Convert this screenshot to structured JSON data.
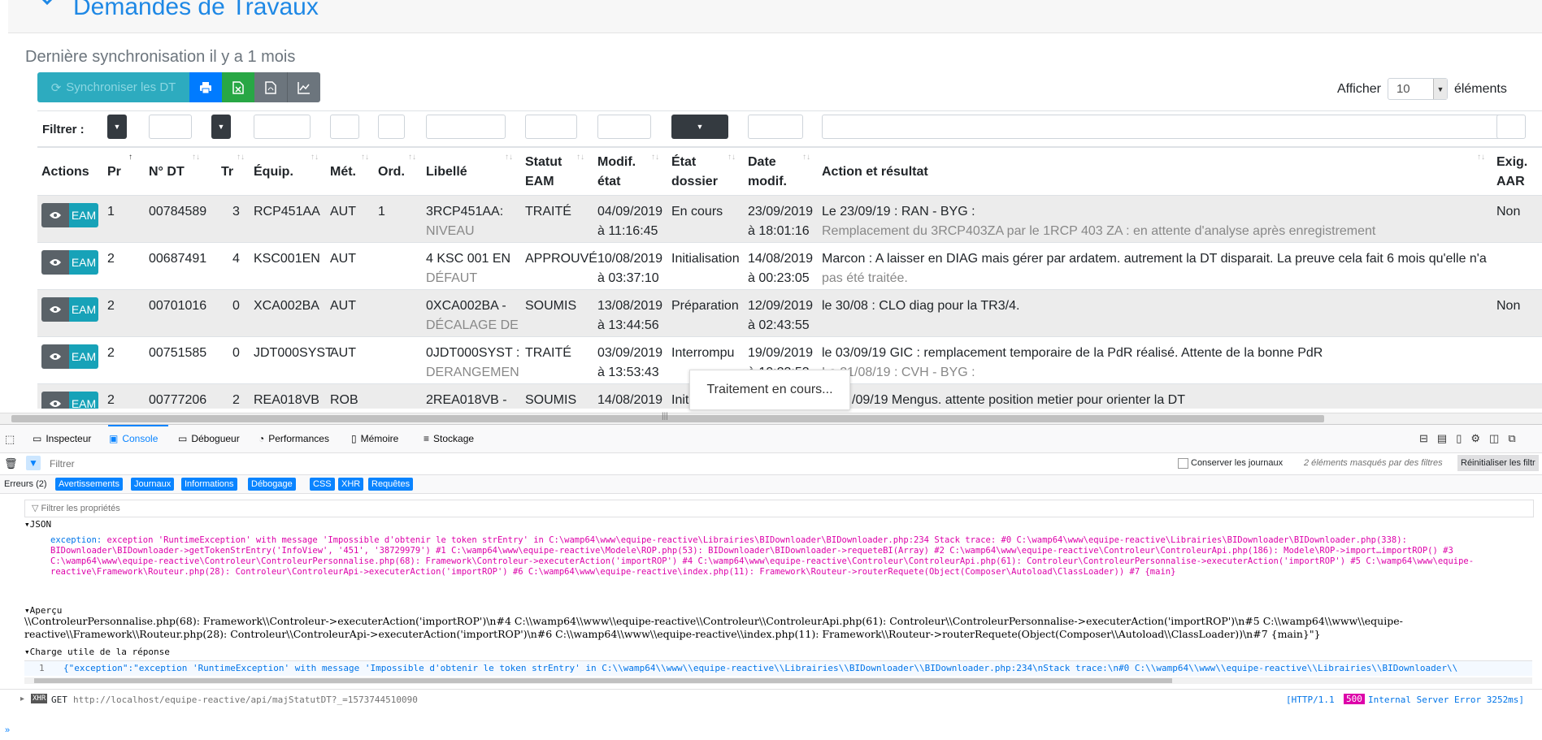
{
  "header": {
    "title": "Demandes de Travaux",
    "sync_text": "Dernière synchronisation il y a 1 mois"
  },
  "toolbar": {
    "sync_label": "Synchroniser les DT",
    "show_label": "Afficher",
    "show_value": "10",
    "elements_label": "éléments"
  },
  "filter": {
    "label": "Filtrer :"
  },
  "columns": {
    "actions": "Actions",
    "pr": "Pr",
    "ndt": "N° DT",
    "tr": "Tr",
    "equip": "Équip.",
    "met": "Mét.",
    "ord": "Ord.",
    "libelle": "Libellé",
    "statut1": "Statut",
    "statut2": "EAM",
    "modif1": "Modif.",
    "modif2": "état",
    "etat1": "État",
    "etat2": "dossier",
    "date1": "Date",
    "date2": "modif.",
    "action": "Action et résultat",
    "exig1": "Exig.",
    "exig2": "AAR"
  },
  "eam_label": "EAM",
  "rows": [
    {
      "pr": "1",
      "ndt": "00784589",
      "tr": "3",
      "equip": "RCP451AA",
      "met": "AUT",
      "ord": "1",
      "lib1": "3RCP451AA:",
      "lib2": "NIVEAU",
      "statut": "TRAITÉ",
      "modif1": "04/09/2019",
      "modif2": "à 11:16:45",
      "etat": "En cours",
      "date1": "23/09/2019",
      "date2": "à 18:01:16",
      "act1": "Le 23/09/19 : RAN - BYG :",
      "act2": "Remplacement du 3RCP403ZA par le 1RCP 403 ZA : en attente d'analyse après enregistrement",
      "exig": "Non"
    },
    {
      "pr": "2",
      "ndt": "00687491",
      "tr": "4",
      "equip": "KSC001EN",
      "met": "AUT",
      "ord": "",
      "lib1": "4 KSC 001 EN",
      "lib2": "DÉFAUT",
      "statut": "APPROUVÉ",
      "modif1": "10/08/2019",
      "modif2": "à 03:37:10",
      "etat": "Initialisation",
      "date1": "14/08/2019",
      "date2": "à 00:23:05",
      "act1": "Marcon : A laisser en DIAG mais gérer par ardatem. autrement la DT disparait. La preuve cela fait 6 mois qu'elle n'a",
      "act2": "pas été traitée.",
      "exig": ""
    },
    {
      "pr": "2",
      "ndt": "00701016",
      "tr": "0",
      "equip": "XCA002BA",
      "met": "AUT",
      "ord": "",
      "lib1": "0XCA002BA -",
      "lib2": "DÉCALAGE DE",
      "statut": "SOUMIS",
      "modif1": "13/08/2019",
      "modif2": "à 13:44:56",
      "etat": "Préparation",
      "date1": "12/09/2019",
      "date2": "à 02:43:55",
      "act1": "le 30/08 : CLO diag pour la TR3/4.",
      "act2": "",
      "exig": "Non"
    },
    {
      "pr": "2",
      "ndt": "00751585",
      "tr": "0",
      "equip": "JDT000SYST",
      "met": "AUT",
      "ord": "",
      "lib1": "0JDT000SYST :",
      "lib2": "DERANGEMEN",
      "statut": "TRAITÉ",
      "modif1": "03/09/2019",
      "modif2": "à 13:53:43",
      "etat": "Interrompu",
      "date1": "19/09/2019",
      "date2": "à 10:23:53",
      "act1": "le 03/09/19 GIC : remplacement temporaire de la PdR réalisé. Attente de la bonne PdR",
      "act2": "Le 21/08/19 : CVH - BYG :",
      "exig": ""
    },
    {
      "pr": "2",
      "ndt": "00777206",
      "tr": "2",
      "equip": "REA018VB",
      "met": "ROB",
      "ord": "",
      "lib1": "2REA018VB -",
      "lib2": "",
      "statut": "SOUMIS",
      "modif1": "14/08/2019",
      "modif2": "",
      "etat": "Init",
      "date1": "",
      "date2": "",
      "act1": "/09/19 Mengus. attente position metier pour orienter la DT",
      "act2": "",
      "exig": ""
    }
  ],
  "processing": "Traitement en cours...",
  "devtools": {
    "tabs": [
      "Inspecteur",
      "Console",
      "Débogueur",
      "Performances",
      "Mémoire",
      "Stockage"
    ],
    "filter_placeholder": "Filtrer",
    "keep_logs": "Conserver les journaux",
    "hidden_msg": "2 éléments masqués par des filtres",
    "reset": "Réinitialiser les filtr",
    "levels": [
      "Erreurs (2)",
      "Avertissements",
      "Journaux",
      "Informations",
      "Débogage",
      "CSS",
      "XHR",
      "Requêtes"
    ],
    "prop_filter": "Filtrer les propriétés",
    "json_label": "JSON",
    "exception_key": "exception:",
    "exception_text": "exception 'RuntimeException' with message 'Impossible d'obtenir le token strEntry' in C:\\wamp64\\www\\equipe-reactive\\Librairies\\BIDownloader\\BIDownloader.php:234 Stack trace: #0 C:\\wamp64\\www\\equipe-reactive\\Librairies\\BIDownloader\\BIDownloader.php(338): BIDownloader\\BIDownloader->getTokenStrEntry('InfoView', '451', '38729979') #1 C:\\wamp64\\www\\equipe-reactive\\Modele\\ROP.php(53): BIDownloader\\BIDownloader->requeteBI(Array) #2 C:\\wamp64\\www\\equipe-reactive\\Controleur\\ControleurApi.php(186): Modele\\ROP->import…importROP() #3 C:\\wamp64\\www\\equipe-reactive\\Controleur\\ControleurPersonnalise.php(68): Framework\\Controleur->executerAction('importROP') #4 C:\\wamp64\\www\\equipe-reactive\\Controleur\\ControleurApi.php(61): Controleur\\ControleurPersonnalise->executerAction('importROP') #5 C:\\wamp64\\www\\equipe-reactive\\Framework\\Routeur.php(28): Controleur\\ControleurApi->executerAction('importROP') #6 C:\\wamp64\\www\\equipe-reactive\\index.php(11): Framework\\Routeur->routerRequete(Object(Composer\\Autoload\\ClassLoader)) #7 {main}",
    "apercu_label": "Aperçu",
    "apercu_text": "\\\\ControleurPersonnalise.php(68): Framework\\\\Controleur->executerAction('importROP')\\n#4 C:\\\\wamp64\\\\www\\\\equipe-reactive\\\\Controleur\\\\ControleurApi.php(61): Controleur\\\\ControleurPersonnalise->executerAction('importROP')\\n#5 C:\\\\wamp64\\\\www\\\\equipe-reactive\\\\Framework\\\\Routeur.php(28): Controleur\\\\ControleurApi->executerAction('importROP')\\n#6 C:\\\\wamp64\\\\www\\\\equipe-reactive\\\\index.php(11): Framework\\\\Routeur->routerRequete(Object(Composer\\\\Autoload\\\\ClassLoader))\\n#7 {main}\"}",
    "payload_label": "Charge utile de la réponse",
    "payload_line_no": "1",
    "payload_text": "{\"exception\":\"exception 'RuntimeException' with message 'Impossible d'obtenir le token strEntry' in C:\\\\wamp64\\\\www\\\\equipe-reactive\\\\Librairies\\\\BIDownloader\\\\BIDownloader.php:234\\nStack trace:\\n#0 C:\\\\wamp64\\\\www\\\\equipe-reactive\\\\Librairies\\\\BIDownloader\\\\",
    "net_method": "GET",
    "net_url": "http://localhost/equipe-reactive/api/majStatutDT?_=1573744510090",
    "net_proto": "[HTTP/1.1",
    "net_code": "500",
    "net_status": "Internal Server Error 3252ms]",
    "xhr_badge": "XHR"
  }
}
